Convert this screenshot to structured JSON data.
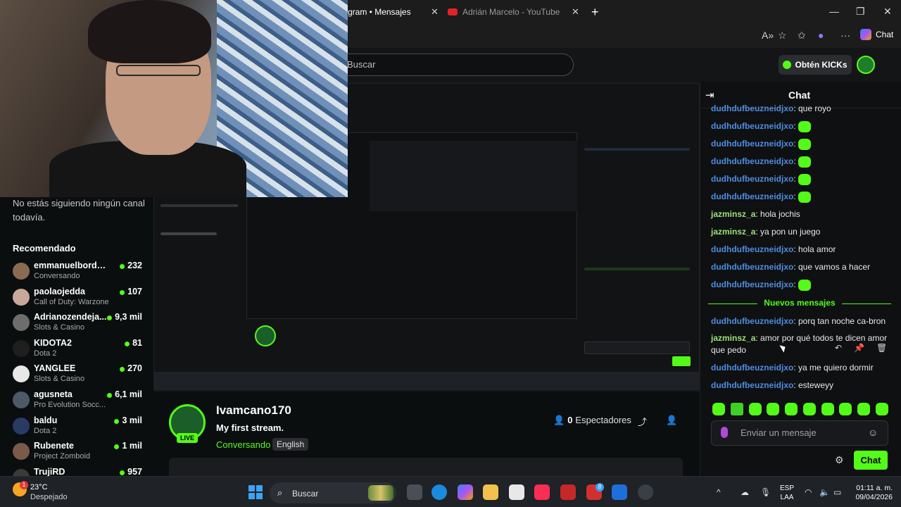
{
  "browser": {
    "tabs": [
      {
        "label": "gram • Mensajes"
      },
      {
        "label": "Adrián Marcelo - YouTube"
      }
    ],
    "new_tab_symbol": "+",
    "copilot_label": "Chat"
  },
  "kick_header": {
    "search_placeholder": "Buscar",
    "kicks_button": "Obtén KICKs"
  },
  "sidebar": {
    "notice": "No estás siguiendo ningún canal todavía.",
    "recommended_title": "Recomendado",
    "items": [
      {
        "name": "emmanuelbordonn",
        "category": "Conversando",
        "viewers": "232",
        "avatar_color": "#8a6b52"
      },
      {
        "name": "paolaojedda",
        "category": "Call of Duty: Warzone",
        "viewers": "107",
        "avatar_color": "#c9a89a"
      },
      {
        "name": "Adrianozendeja...",
        "category": "Slots & Casino",
        "viewers": "9,3 mil",
        "avatar_color": "#6d6d6d"
      },
      {
        "name": "KIDOTA2",
        "category": "Dota 2",
        "viewers": "81",
        "avatar_color": "#1f1f1f"
      },
      {
        "name": "YANGLEE",
        "category": "Slots & Casino",
        "viewers": "270",
        "avatar_color": "#e8e8e8"
      },
      {
        "name": "agusneta",
        "category": "Pro Evolution Socc...",
        "viewers": "6,1 mil",
        "avatar_color": "#4d5a66"
      },
      {
        "name": "baldu",
        "category": "Dota 2",
        "viewers": "3 mil",
        "avatar_color": "#2a3b63"
      },
      {
        "name": "Rubenete",
        "category": "Project Zomboid",
        "viewers": "1 mil",
        "avatar_color": "#7a5a48"
      },
      {
        "name": "TrujiRD",
        "category": "",
        "viewers": "957",
        "avatar_color": "#3a3a3a"
      }
    ]
  },
  "stream": {
    "channel": "Ivamcano170",
    "title": "My first stream.",
    "category": "Conversando",
    "language": "English",
    "live_badge": "LIVE",
    "viewers_count": "0",
    "viewers_label": "Espectadores"
  },
  "chat": {
    "title": "Chat",
    "messages": [
      {
        "user": "dudhdufbeuzneidjxo",
        "text": "que royo",
        "emote": false,
        "user_color": "blue"
      },
      {
        "user": "dudhdufbeuzneidjxo",
        "text": "",
        "emote": true,
        "user_color": "blue"
      },
      {
        "user": "dudhdufbeuzneidjxo",
        "text": "",
        "emote": true,
        "user_color": "blue"
      },
      {
        "user": "dudhdufbeuzneidjxo",
        "text": "",
        "emote": true,
        "user_color": "blue"
      },
      {
        "user": "dudhdufbeuzneidjxo",
        "text": "",
        "emote": true,
        "user_color": "blue"
      },
      {
        "user": "dudhdufbeuzneidjxo",
        "text": "",
        "emote": true,
        "user_color": "blue"
      },
      {
        "user": "jazminsz_a",
        "text": "hola jochis",
        "emote": false,
        "user_color": "green"
      },
      {
        "user": "jazminsz_a",
        "text": "ya pon un juego",
        "emote": false,
        "user_color": "green"
      },
      {
        "user": "dudhdufbeuzneidjxo",
        "text": "hola amor",
        "emote": false,
        "user_color": "blue"
      },
      {
        "user": "dudhdufbeuzneidjxo",
        "text": "que vamos a hacer",
        "emote": false,
        "user_color": "blue"
      },
      {
        "user": "dudhdufbeuzneidjxo",
        "text": "",
        "emote": true,
        "user_color": "blue"
      }
    ],
    "new_messages_label": "Nuevos mensajes",
    "new_messages": [
      {
        "user": "dudhdufbeuzneidjxo",
        "text": "porq tan noche ca-bron",
        "user_color": "blue"
      },
      {
        "user": "jazminsz_a",
        "text": "amor por qué todos te dicen amor que pedo",
        "user_color": "green"
      },
      {
        "user": "dudhdufbeuzneidjxo",
        "text": "ya me quiero dormir",
        "user_color": "blue"
      },
      {
        "user": "dudhdufbeuzneidjxo",
        "text": "esteweyy",
        "user_color": "blue"
      }
    ],
    "input_placeholder": "Enviar un mensaje",
    "send_button": "Chat"
  },
  "taskbar": {
    "weather_temp": "23°C",
    "weather_desc": "Despejado",
    "weather_badge": "1",
    "search_label": "Buscar",
    "lang_line1": "ESP",
    "lang_line2": "LAA",
    "time": "01:11 a. m.",
    "date": "09/04/2026",
    "badges": {
      "acrobat": "8"
    }
  },
  "colors": {
    "kick_green": "#53fc18",
    "username_blue": "#4e8de0",
    "username_green": "#9ce07a"
  }
}
